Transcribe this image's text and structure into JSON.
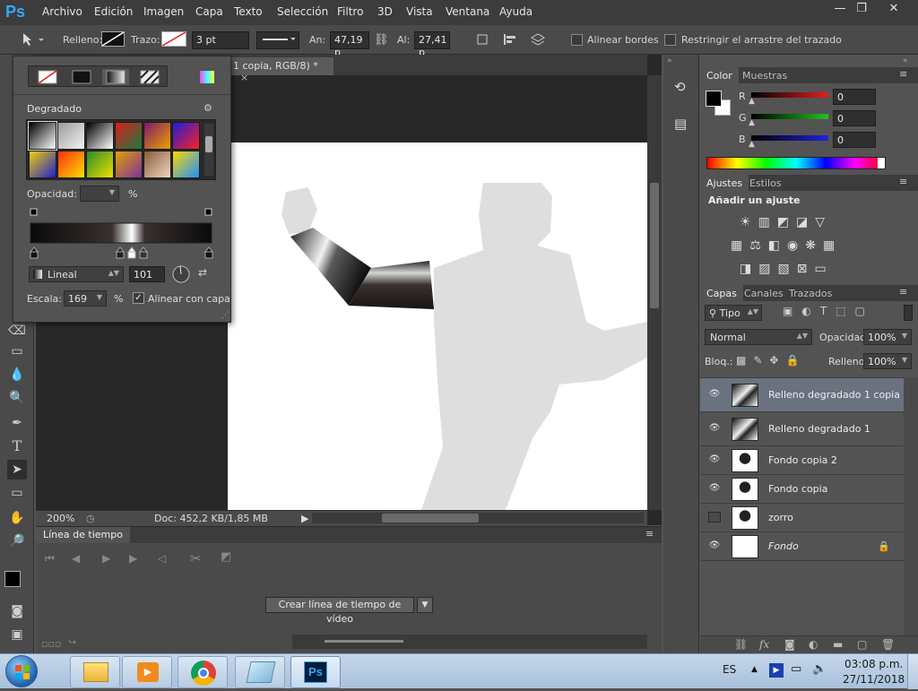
{
  "app": {
    "logo": "Ps"
  },
  "menu": [
    "Archivo",
    "Edición",
    "Imagen",
    "Capa",
    "Texto",
    "Selección",
    "Filtro",
    "3D",
    "Vista",
    "Ventana",
    "Ayuda"
  ],
  "window_buttons": [
    "—",
    "❐",
    "✕"
  ],
  "options": {
    "fill_label": "Relleno:",
    "stroke_label": "Trazo:",
    "stroke_width": "3 pt",
    "width_label": "An:",
    "width_value": "47,19 p",
    "height_label": "Al:",
    "height_value": "27,41 p",
    "align_edges": "Alinear bordes",
    "constrain_path": "Restringir el arrastre del trazado"
  },
  "document": {
    "tab_title": "1 copia, RGB/8) *",
    "zoom": "200%",
    "doc_info": "Doc: 452,2 KB/1,85 MB"
  },
  "gradient_popup": {
    "section_title": "Degradado",
    "opacity_label": "Opacidad:",
    "percent": "%",
    "style": "Lineal",
    "angle": "101",
    "scale_label": "Escala:",
    "scale": "169",
    "align_layer": "Alinear con capa",
    "swatches": [
      [
        "#000000",
        "#ffffff"
      ],
      [
        "#9a9a9a",
        "#f4f4f4"
      ],
      [
        "#000000",
        "#ffffff"
      ],
      [
        "#d81e1e",
        "#1c7a3a"
      ],
      [
        "#7a1b6b",
        "#f0a000"
      ],
      [
        "#1d1dd8",
        "#ff2020"
      ],
      [
        "#f0d000",
        "#1d1dd8"
      ],
      [
        "#ff3010",
        "#f8e000"
      ],
      [
        "#2a8a2a",
        "#f0e000"
      ],
      [
        "#e0a000",
        "#8030a0"
      ],
      [
        "#8a5a3a",
        "#f0d8c0"
      ],
      [
        "#ffd700",
        "#1e90ff"
      ]
    ]
  },
  "timeline": {
    "title": "Línea de tiempo",
    "create_button": "Crear línea de tiempo de vídeo"
  },
  "color_panel": {
    "tabs": [
      "Color",
      "Muestras"
    ],
    "channels": [
      {
        "name": "R",
        "value": "0"
      },
      {
        "name": "G",
        "value": "0"
      },
      {
        "name": "B",
        "value": "0"
      }
    ]
  },
  "adjust_panel": {
    "tabs": [
      "Ajustes",
      "Estilos"
    ],
    "title": "Añadir un ajuste"
  },
  "layers_panel": {
    "tabs": [
      "Capas",
      "Canales",
      "Trazados"
    ],
    "filter_kind": "Tipo",
    "blend_mode": "Normal",
    "opacity_label": "Opacidad:",
    "opacity": "100%",
    "lock_label": "Bloq.:",
    "fill_label": "Relleno:",
    "fill": "100%",
    "layers": [
      {
        "name": "Relleno degradado 1 copia",
        "visible": true,
        "selected": true,
        "italic": false
      },
      {
        "name": "Relleno degradado 1",
        "visible": true,
        "selected": false,
        "italic": false
      },
      {
        "name": "Fondo copia 2",
        "visible": true,
        "selected": false,
        "italic": false
      },
      {
        "name": "Fondo copia",
        "visible": true,
        "selected": false,
        "italic": false
      },
      {
        "name": "zorro",
        "visible": false,
        "selected": false,
        "italic": false
      },
      {
        "name": "Fondo",
        "visible": true,
        "selected": false,
        "italic": true
      }
    ]
  },
  "taskbar": {
    "language": "ES",
    "time": "03:08 p.m.",
    "date": "27/11/2018",
    "ps_label": "Ps"
  },
  "colors": {
    "accent": "#31a8ff",
    "selected_layer": "#6a7280"
  }
}
